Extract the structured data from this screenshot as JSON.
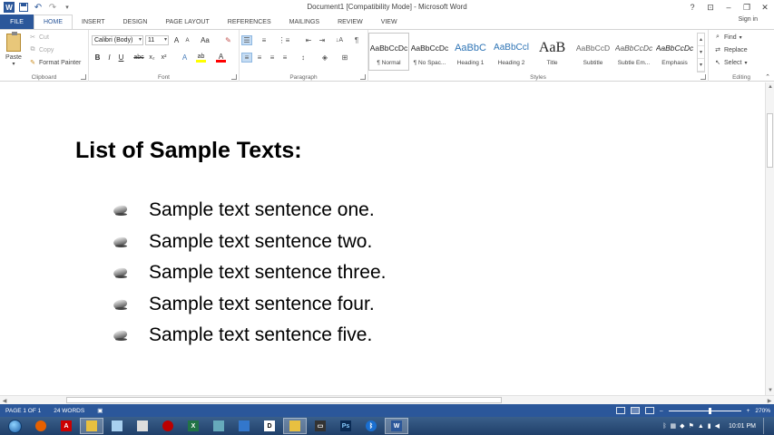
{
  "app": {
    "title": "Document1 [Compatibility Mode] - Microsoft Word",
    "accent": "#2b579a"
  },
  "quick_access": {
    "icons": [
      "word-logo-icon",
      "save-icon",
      "undo-icon",
      "redo-icon",
      "customize-icon"
    ]
  },
  "window_controls": {
    "help": "?",
    "ribbon_options": "⊡",
    "minimize": "–",
    "restore": "❐",
    "close": "✕"
  },
  "ribbon_tabs": {
    "file": "FILE",
    "items": [
      "HOME",
      "INSERT",
      "DESIGN",
      "PAGE LAYOUT",
      "REFERENCES",
      "MAILINGS",
      "REVIEW",
      "VIEW"
    ],
    "active": "HOME",
    "signin": "Sign in"
  },
  "clipboard": {
    "paste": "Paste",
    "cut": "Cut",
    "copy": "Copy",
    "format_painter": "Format Painter",
    "label": "Clipboard"
  },
  "font": {
    "name": "Calibri (Body)",
    "size": "11",
    "label": "Font",
    "bold": "B",
    "italic": "I",
    "underline": "U",
    "strike": "abc",
    "subscript": "x₂",
    "superscript": "x²",
    "grow": "A",
    "shrink": "A",
    "case": "Aa",
    "clear": "✎",
    "effects": "A",
    "highlight": "ab",
    "color": "A",
    "highlight_color": "#ffff00",
    "font_color": "#ff0000"
  },
  "paragraph": {
    "label": "Paragraph",
    "pilcrow": "¶",
    "sort": "↓A"
  },
  "styles": {
    "label": "Styles",
    "items": [
      {
        "preview": "AaBbCcDc",
        "name": "¶ Normal"
      },
      {
        "preview": "AaBbCcDc",
        "name": "¶ No Spac..."
      },
      {
        "preview": "AaBbC",
        "name": "Heading 1"
      },
      {
        "preview": "AaBbCcl",
        "name": "Heading 2"
      },
      {
        "preview": "AaB",
        "name": "Title"
      },
      {
        "preview": "AaBbCcD",
        "name": "Subtitle"
      },
      {
        "preview": "AaBbCcDc",
        "name": "Subtle Em..."
      },
      {
        "preview": "AaBbCcDc",
        "name": "Emphasis"
      }
    ]
  },
  "editing": {
    "label": "Editing",
    "find": "Find",
    "replace": "Replace",
    "select": "Select"
  },
  "document": {
    "heading": "List of Sample Texts:",
    "items": [
      "Sample text sentence one.",
      "Sample text sentence two.",
      "Sample text sentence three.",
      "Sample text sentence four.",
      "Sample text sentence five."
    ]
  },
  "status": {
    "page": "PAGE 1 OF 1",
    "words": "24 WORDS",
    "zoom_out": "–",
    "zoom_in": "+",
    "zoom": "270%"
  },
  "taskbar": {
    "time": "10:01 PM",
    "apps": [
      "firefox",
      "acrobat",
      "explorer",
      "notepad",
      "tool",
      "red-ball",
      "excel",
      "rdp",
      "blue-app",
      "dolphin",
      "folder",
      "chip",
      "photoshop",
      "bluetooth",
      "word"
    ]
  }
}
